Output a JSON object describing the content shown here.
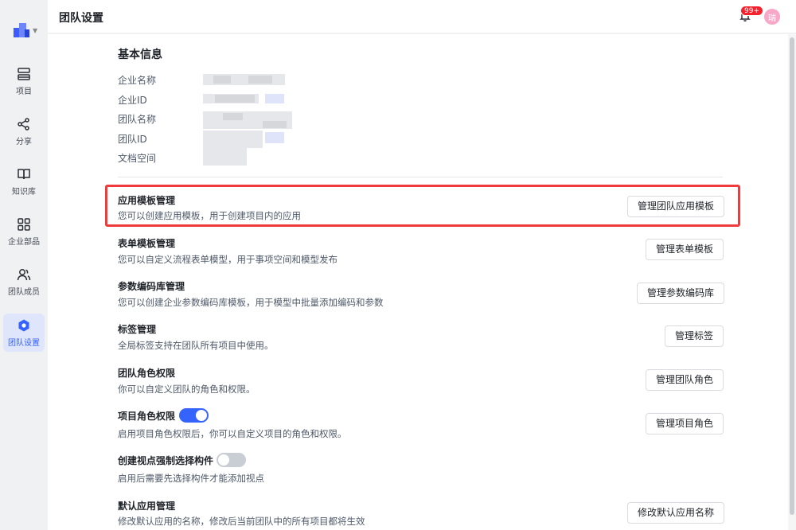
{
  "header": {
    "title": "团队设置",
    "notification_count": "99+",
    "avatar_text": "瑞"
  },
  "sidebar": {
    "items": [
      {
        "label": "项目",
        "icon": "project-icon"
      },
      {
        "label": "分享",
        "icon": "share-icon"
      },
      {
        "label": "知识库",
        "icon": "book-icon"
      },
      {
        "label": "企业部品",
        "icon": "grid-icon"
      },
      {
        "label": "团队成员",
        "icon": "members-icon"
      },
      {
        "label": "团队设置",
        "icon": "settings-icon",
        "active": true
      }
    ]
  },
  "basic_info": {
    "title": "基本信息",
    "labels": [
      "企业名称",
      "企业ID",
      "团队名称",
      "团队ID",
      "文档空间"
    ]
  },
  "settings": [
    {
      "title": "应用模板管理",
      "desc": "您可以创建应用模板，用于创建项目内的应用",
      "button": "管理团队应用模板"
    },
    {
      "title": "表单模板管理",
      "desc": "您可以自定义流程表单模型，用于事项空间和模型发布",
      "button": "管理表单模板"
    },
    {
      "title": "参数编码库管理",
      "desc": "您可以创建企业参数编码库模板，用于模型中批量添加编码和参数",
      "button": "管理参数编码库"
    },
    {
      "title": "标签管理",
      "desc": "全局标签支持在团队所有项目中使用。",
      "button": "管理标签"
    },
    {
      "title": "团队角色权限",
      "desc": "你可以自定义团队的角色和权限。",
      "button": "管理团队角色"
    },
    {
      "title": "项目角色权限",
      "desc": "启用项目角色权限后，你可以自定义项目的角色和权限。",
      "button": "管理项目角色",
      "toggle": true
    },
    {
      "title": "创建视点强制选择构件",
      "desc": "启用后需要先选择构件才能添加视点",
      "toggle": false
    },
    {
      "title": "默认应用管理",
      "desc": "修改默认应用的名称，修改后当前团队中的所有项目都将生效",
      "button": "修改默认应用名称"
    }
  ],
  "colors": {
    "accent": "#3563ff",
    "highlight": "#ef3b3b",
    "badge": "#f5222d"
  }
}
